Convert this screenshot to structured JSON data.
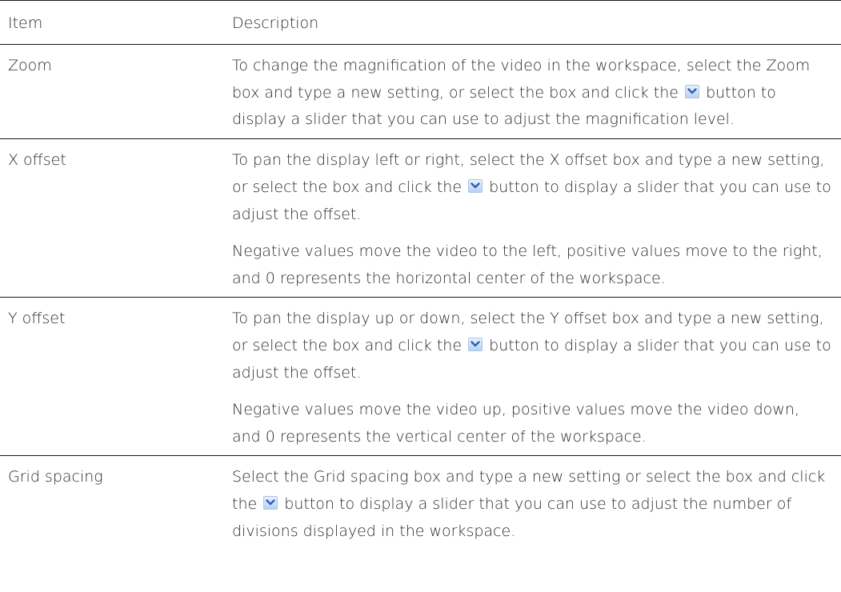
{
  "header": {
    "item_label": "Item",
    "description_label": "Description"
  },
  "rows": [
    {
      "item": "Zoom",
      "p1_a": "To change the magnification of the video in the workspace, select the Zoom box and type a new setting, or select the box and click the",
      "p1_b": "button to display a slider that you can use to adjust the magnification level."
    },
    {
      "item": "X offset",
      "p1_a": "To pan the display left or right, select the X offset box and type a new setting, or select the box and click the",
      "p1_b": "button to display a slider that you can use to adjust the offset.",
      "p2": "Negative values move the video to the left, positive values move to the right, and 0 represents the horizontal center of the workspace."
    },
    {
      "item": "Y offset",
      "p1_a": "To pan the display up or down, select the Y offset box and type a new setting, or select the box and click the",
      "p1_b": "button to display a slider that you can use to adjust the offset.",
      "p2": "Negative values move the video up, positive values move the video down, and 0 represents the vertical center of the workspace."
    },
    {
      "item": "Grid spacing",
      "p1_a": "Select the Grid spacing box and type a new setting or select the box and click the",
      "p1_b": "button to display a slider that you can use to adjust the number of divisions displayed in the workspace."
    }
  ],
  "icons": {
    "dropdown_button": "chevron-down-icon"
  },
  "colors": {
    "text": "#2b2b2b",
    "rule": "#1a1a1a",
    "button_fill_top": "#eaf2fd",
    "button_fill_bottom": "#b8d1f3",
    "chevron": "#2a5fb8"
  }
}
